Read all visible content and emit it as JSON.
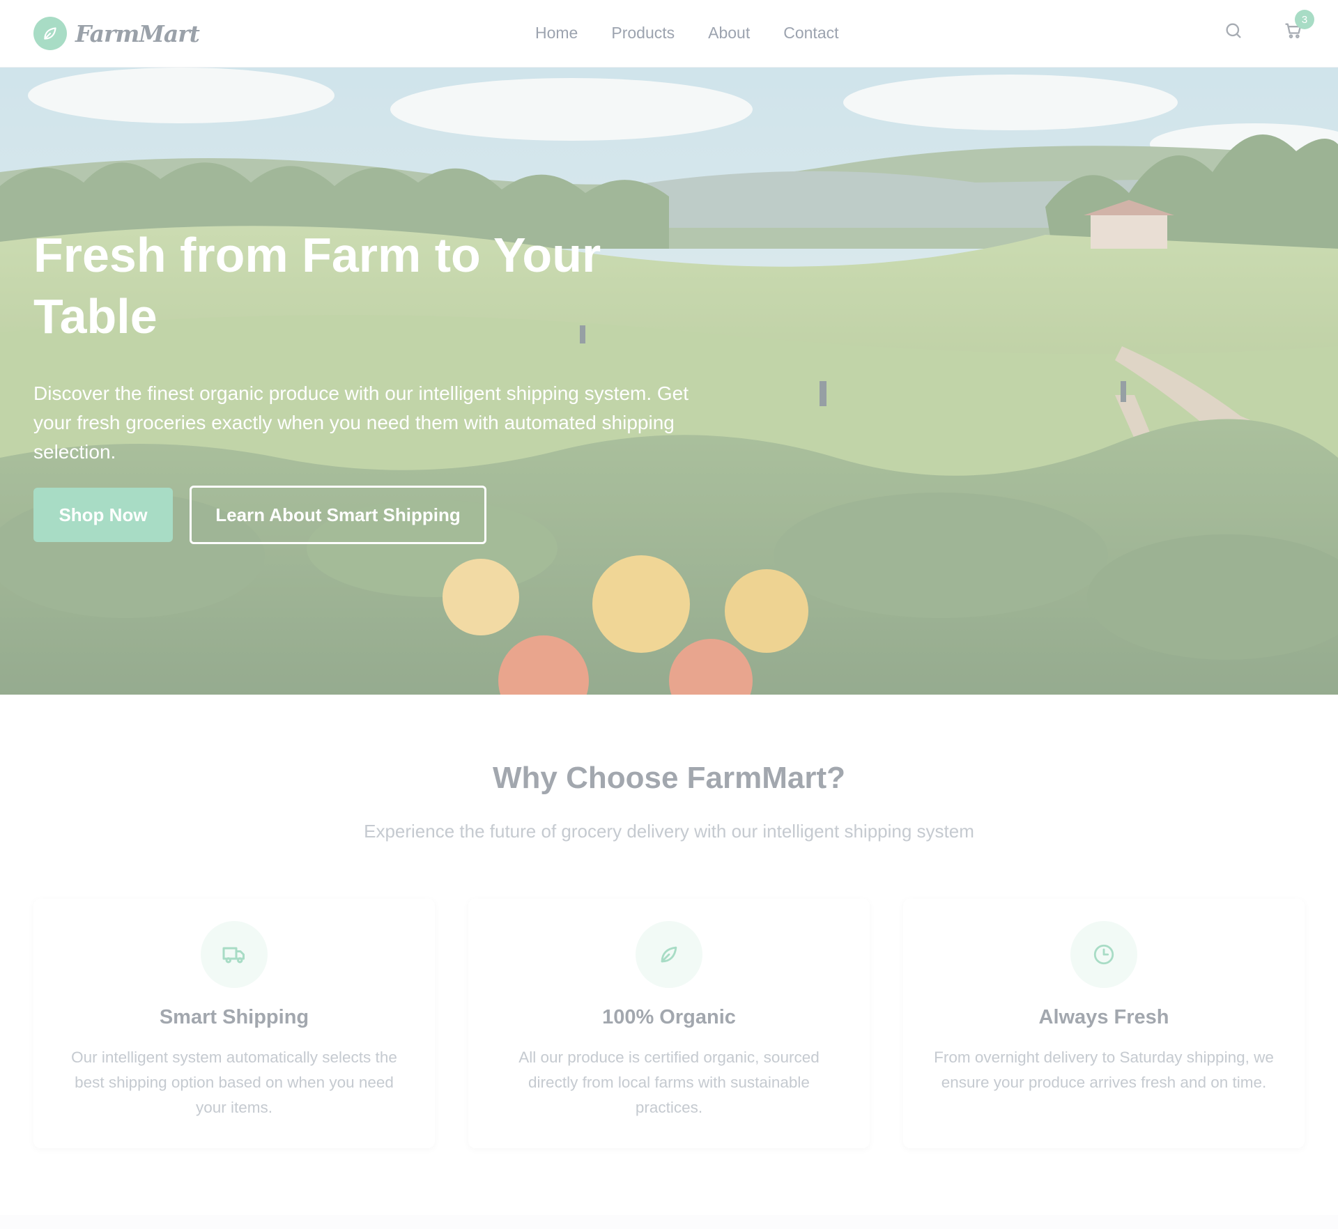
{
  "brand": {
    "name": "FarmMart",
    "accent": "#a8dcc5"
  },
  "nav": {
    "items": [
      "Home",
      "Products",
      "About",
      "Contact"
    ]
  },
  "header": {
    "cart_count": "3",
    "search_icon": "search-icon",
    "cart_icon": "cart-icon"
  },
  "hero": {
    "title": "Fresh from Farm to Your Table",
    "subtitle": "Discover the finest organic produce with our intelligent shipping system. Get your fresh groceries exactly when you need them with automated shipping selection.",
    "primary_button": "Shop Now",
    "secondary_button": "Learn About Smart Shipping"
  },
  "why": {
    "title": "Why Choose FarmMart?",
    "subtitle": "Experience the future of grocery delivery with our intelligent shipping system",
    "cards": [
      {
        "icon": "truck-icon",
        "title": "Smart Shipping",
        "text": "Our intelligent system automatically selects the best shipping option based on when you need your items."
      },
      {
        "icon": "leaf-icon",
        "title": "100% Organic",
        "text": "All our produce is certified organic, sourced directly from local farms with sustainable practices."
      },
      {
        "icon": "clock-icon",
        "title": "Always Fresh",
        "text": "From overnight delivery to Saturday shipping, we ensure your produce arrives fresh and on time."
      }
    ]
  }
}
